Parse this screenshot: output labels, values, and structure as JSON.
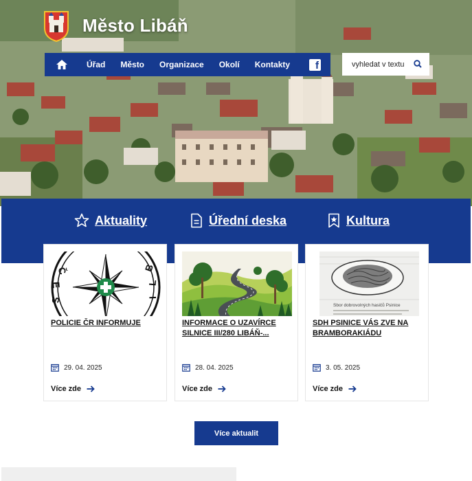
{
  "header": {
    "site_title": "Město Libáň"
  },
  "nav": {
    "items": [
      {
        "label": "Úřad"
      },
      {
        "label": "Město"
      },
      {
        "label": "Organizace"
      },
      {
        "label": "Okolí"
      },
      {
        "label": "Kontakty"
      }
    ],
    "facebook_glyph": "f"
  },
  "search": {
    "placeholder": "vyhledat v textu"
  },
  "tabs": [
    {
      "label": "Aktuality",
      "icon": "star-icon"
    },
    {
      "label": "Úřední deska",
      "icon": "document-icon"
    },
    {
      "label": "Kultura",
      "icon": "bookmark-icon"
    }
  ],
  "cards": [
    {
      "title": "POLICIE ČR INFORMUJE",
      "date": "29. 04. 2025",
      "more": "Více zde",
      "image_text": "ČESK BLIKY"
    },
    {
      "title": "INFORMACE O UZAVÍRCE SILNICE III/280 LIBÁŇ-...",
      "date": "28. 04. 2025",
      "more": "Více zde"
    },
    {
      "title": "SDH PSINICE VÁS ZVE NA BRAMBORAKIÁDU",
      "date": "3. 05. 2025",
      "more": "Více zde",
      "image_text": "Sbor dobrovolných hasičů Psinice"
    }
  ],
  "more_news_button": "Více aktualit",
  "colors": {
    "brand_blue": "#163a8f"
  }
}
